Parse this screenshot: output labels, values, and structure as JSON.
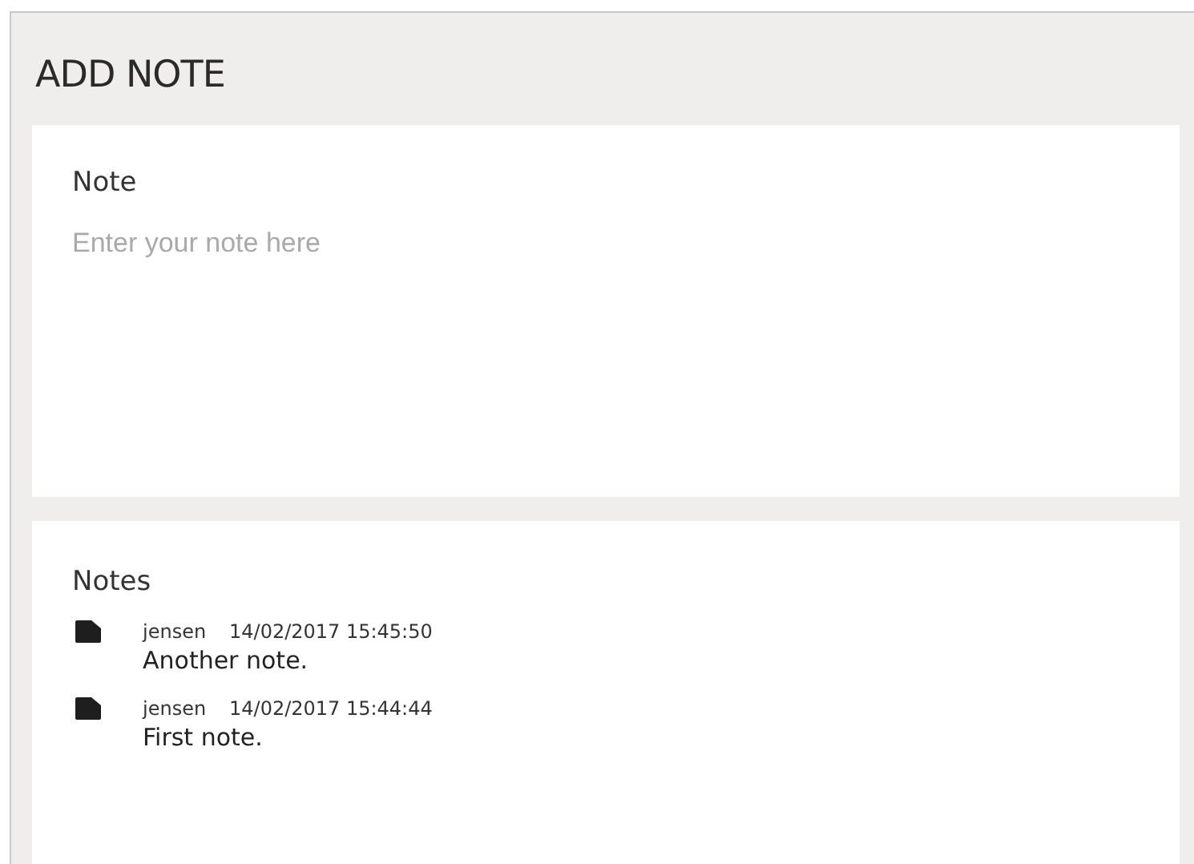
{
  "title": "ADD NOTE",
  "note_field": {
    "label": "Note",
    "placeholder": "Enter your note here"
  },
  "notes": {
    "heading": "Notes",
    "items": [
      {
        "author": "jensen",
        "timestamp": "14/02/2017 15:45:50",
        "text": "Another note."
      },
      {
        "author": "jensen",
        "timestamp": "14/02/2017 15:44:44",
        "text": "First note."
      }
    ]
  }
}
